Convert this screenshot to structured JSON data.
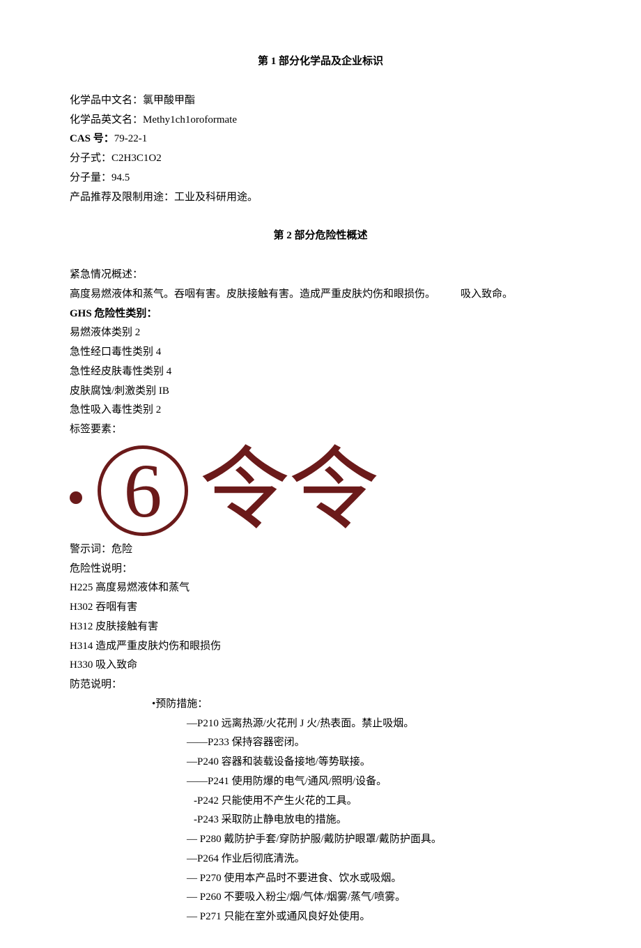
{
  "section1": {
    "title": "第 1 部分化学品及企业标识",
    "name_cn_label": "化学品中文名：",
    "name_cn": "氯甲酸甲酯",
    "name_en_label": "化学品英文名：",
    "name_en": "Methy1ch1oroformate",
    "cas_label": "CAS 号：",
    "cas": "79-22-1",
    "formula_label": "分子式：",
    "formula": "C2H3C1O2",
    "mw_label": "分子量：",
    "mw": "94.5",
    "use_label": "产品推荐及限制用途：",
    "use": "工业及科研用途。"
  },
  "section2": {
    "title": "第 2 部分危险性概述",
    "emergency_label": "紧急情况概述：",
    "emergency_text": "高度易燃液体和蒸气。吞咽有害。皮肤接触有害。造成严重皮肤灼伤和眼损伤。",
    "emergency_extra": "吸入致命。",
    "ghs_label": "GHS 危险性类别：",
    "ghs_items": [
      "易燃液体类别 2",
      "急性经口毒性类别 4",
      "急性经皮肤毒性类别 4",
      "皮肤腐蚀/刺激类别 IB",
      "急性吸入毒性类别 2"
    ],
    "label_elements": "标签要素：",
    "pictogram": {
      "six": "6",
      "ling1": "令",
      "ling2": "令"
    },
    "signal_label": "警示词：",
    "signal": "危险",
    "hazard_label": "危险性说明：",
    "hazard_statements": [
      "H225 高度易燃液体和蒸气",
      "H302 吞咽有害",
      "H312 皮肤接触有害",
      "H314 造成严重皮肤灼伤和眼损伤",
      "H330 吸入致命"
    ],
    "precaution_label": "防范说明：",
    "prevention_label": "•预防措施：",
    "precautions": [
      {
        "prefix": "—",
        "text": "P210 远离热源/火花刑 J 火/热表面。禁止吸烟。"
      },
      {
        "prefix": "——",
        "text": "P233 保持容器密闭。"
      },
      {
        "prefix": "—",
        "text": "P240 容器和装载设备接地/等势联接。"
      },
      {
        "prefix": "——",
        "text": "P241 使用防爆的电气/通风/照明/设备。"
      },
      {
        "prefix": "-",
        "text": "P242 只能使用不产生火花的工具。"
      },
      {
        "prefix": "-",
        "text": "P243 采取防止静电放电的措施。"
      },
      {
        "prefix": "—   ",
        "text": "P280 戴防护手套/穿防护服/戴防护眼罩/戴防护面具。"
      },
      {
        "prefix": "—",
        "text": "P264 作业后彻底清洗。"
      },
      {
        "prefix": "—   ",
        "text": "P270 使用本产品时不要进食、饮水或吸烟。"
      },
      {
        "prefix": "—   ",
        "text": "P260 不要吸入粉尘/烟/气体/烟雾/蒸气/喷雾。"
      },
      {
        "prefix": "—   ",
        "text": "P271 只能在室外或通风良好处使用。"
      }
    ]
  }
}
